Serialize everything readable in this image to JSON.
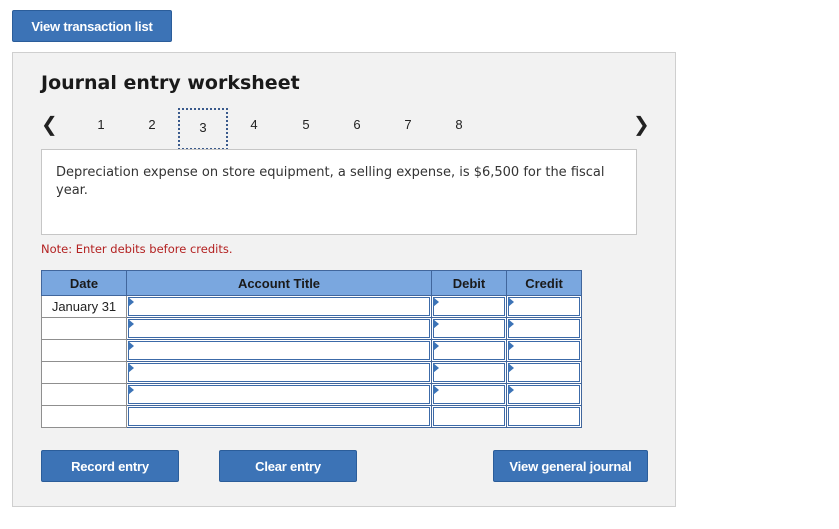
{
  "top_button": "View transaction list",
  "worksheet": {
    "title": "Journal entry worksheet",
    "prev_icon": "chevron-left-icon",
    "next_icon": "chevron-right-icon",
    "steps": [
      "1",
      "2",
      "3",
      "4",
      "5",
      "6",
      "7",
      "8"
    ],
    "active_step": "3",
    "description": "Depreciation expense on store equipment, a selling expense, is $6,500 for the fiscal year.",
    "note": "Note: Enter debits before credits."
  },
  "table": {
    "headers": {
      "date": "Date",
      "account": "Account Title",
      "debit": "Debit",
      "credit": "Credit"
    },
    "rows": [
      {
        "date": "January 31",
        "account": "",
        "debit": "",
        "credit": ""
      },
      {
        "date": "",
        "account": "",
        "debit": "",
        "credit": ""
      },
      {
        "date": "",
        "account": "",
        "debit": "",
        "credit": ""
      },
      {
        "date": "",
        "account": "",
        "debit": "",
        "credit": ""
      },
      {
        "date": "",
        "account": "",
        "debit": "",
        "credit": ""
      },
      {
        "date": "",
        "account": "",
        "debit": "",
        "credit": ""
      }
    ]
  },
  "buttons": {
    "record": "Record entry",
    "clear": "Clear entry",
    "view_journal": "View general journal"
  },
  "colors": {
    "button": "#3c73b6",
    "header": "#7aa7df",
    "note": "#b32121",
    "panel": "#f2f2f2"
  }
}
